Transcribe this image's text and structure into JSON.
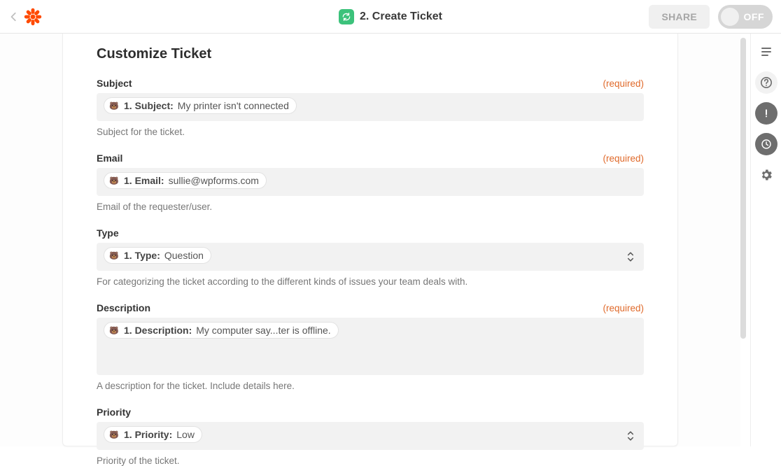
{
  "topbar": {
    "step_label": "2. Create Ticket",
    "share_label": "SHARE",
    "toggle_label": "OFF"
  },
  "panel": {
    "title": "Customize Ticket"
  },
  "fields": {
    "subject": {
      "label": "Subject",
      "required": "(required)",
      "pill_label": "1. Subject:",
      "pill_value": "My printer isn't connected",
      "help": "Subject for the ticket."
    },
    "email": {
      "label": "Email",
      "required": "(required)",
      "pill_label": "1. Email:",
      "pill_value": "sullie@wpforms.com",
      "help": "Email of the requester/user."
    },
    "type": {
      "label": "Type",
      "pill_label": "1. Type:",
      "pill_value": "Question",
      "help": "For categorizing the ticket according to the different kinds of issues your team deals with."
    },
    "description": {
      "label": "Description",
      "required": "(required)",
      "pill_label": "1. Description:",
      "pill_value": "My computer say...ter is offline.",
      "help": "A description for the ticket. Include details here."
    },
    "priority": {
      "label": "Priority",
      "pill_label": "1. Priority:",
      "pill_value": "Low",
      "help": "Priority of the ticket."
    }
  }
}
